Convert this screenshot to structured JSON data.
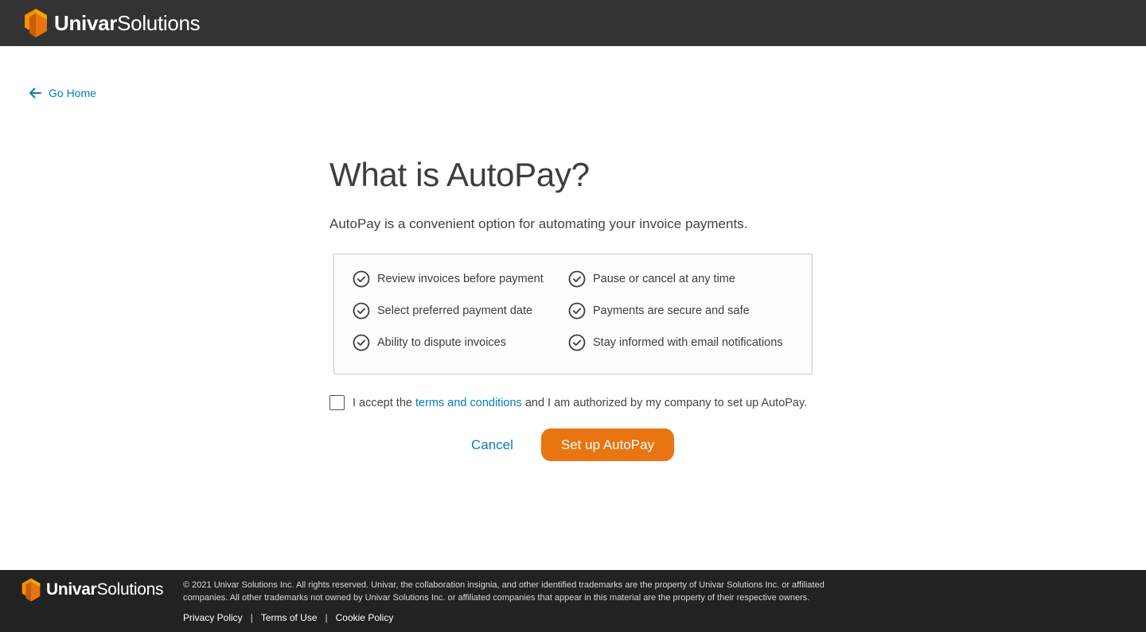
{
  "header": {
    "logo_bold": "Univar",
    "logo_light": "Solutions"
  },
  "nav": {
    "go_home": "Go Home"
  },
  "main": {
    "title": "What is AutoPay?",
    "subtitle": "AutoPay is a convenient option for automating your invoice payments.",
    "benefits": [
      "Review invoices before payment",
      "Pause or cancel at any time",
      "Select preferred payment date",
      "Payments are secure and safe",
      "Ability to dispute invoices",
      "Stay informed with email notifications"
    ],
    "accept": {
      "prefix": "I accept the ",
      "link": "terms and conditions",
      "suffix": " and I am authorized by my company to set up AutoPay.",
      "checked": false
    },
    "actions": {
      "cancel": "Cancel",
      "primary": "Set up AutoPay"
    }
  },
  "footer": {
    "logo_bold": "Univar",
    "logo_light": "Solutions",
    "legal_line1": "© 2021 Univar Solutions Inc. All rights reserved. Univar, the collaboration insignia, and other identified trademarks are the property of Univar Solutions Inc. or affiliated",
    "legal_line2": "companies. All other trademarks not owned by Univar Solutions Inc. or affiliated companies that appear in this material are the property of their respective owners.",
    "links": [
      "Privacy Policy",
      "Terms of Use",
      "Cookie Policy"
    ],
    "separator": "|"
  },
  "colors": {
    "header_bg": "#333333",
    "footer_bg": "#222222",
    "accent_orange": "#e87511",
    "link_blue": "#0a7bb8"
  },
  "icons": {
    "logo": "univar-cube-logo-icon",
    "back": "arrow-left-icon",
    "benefit": "check-circle-icon"
  }
}
